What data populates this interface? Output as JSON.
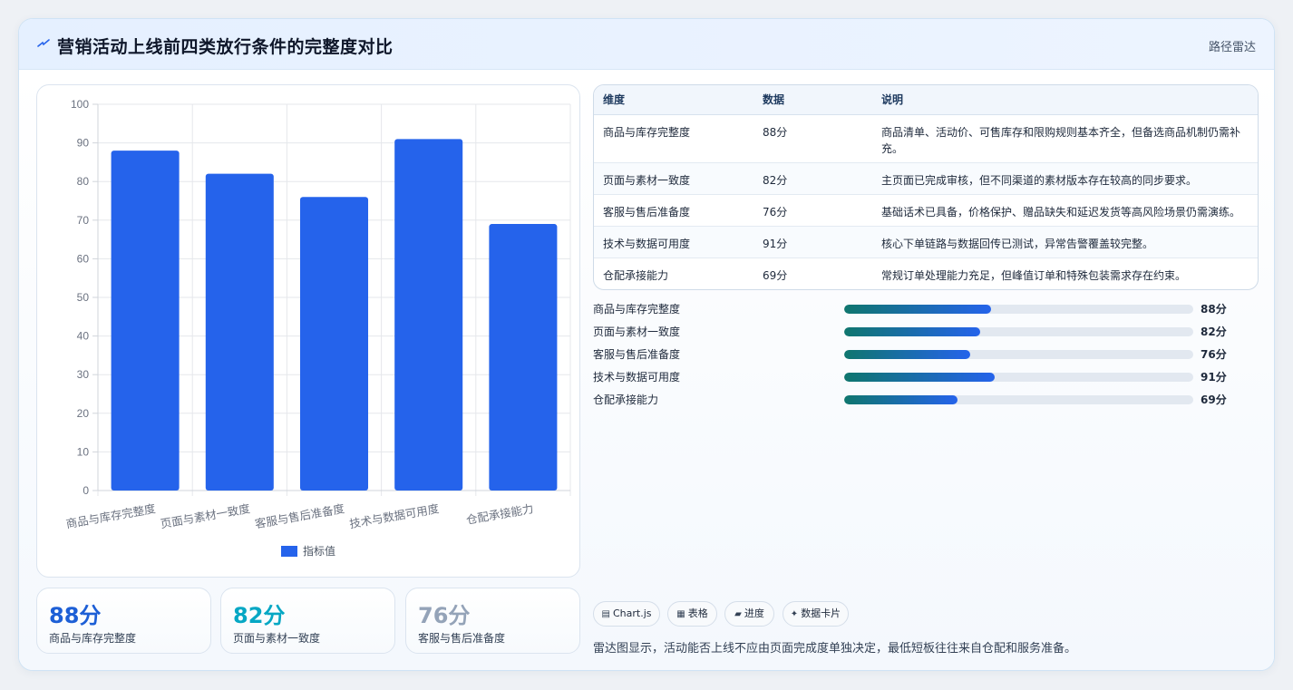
{
  "header": {
    "title": "营销活动上线前四类放行条件的完整度对比",
    "mode_label": "路径雷达",
    "logo_icon": "lightning-icon"
  },
  "chart_data": {
    "type": "bar",
    "categories": [
      "商品与库存完整度",
      "页面与素材一致度",
      "客服与售后准备度",
      "技术与数据可用度",
      "仓配承接能力"
    ],
    "series": [
      {
        "name": "指标值",
        "values": [
          88,
          82,
          76,
          91,
          69
        ],
        "color": "#2563eb"
      }
    ],
    "ylim": [
      0,
      100
    ],
    "yticks": [
      0,
      10,
      20,
      30,
      40,
      50,
      60,
      70,
      80,
      90,
      100
    ],
    "grid": true,
    "legend": "bottom"
  },
  "stats": [
    {
      "value": "88分",
      "label": "商品与库存完整度",
      "color": "#1d5fd6"
    },
    {
      "value": "82分",
      "label": "页面与素材一致度",
      "color": "#06a7c4"
    },
    {
      "value": "76分",
      "label": "客服与售后准备度",
      "color": "#94a3b8"
    }
  ],
  "table": {
    "headers": [
      "维度",
      "数据",
      "说明"
    ],
    "rows": [
      {
        "dim": "商品与库存完整度",
        "val": "88分",
        "note": "商品清单、活动价、可售库存和限购规则基本齐全，但备选商品机制仍需补充。"
      },
      {
        "dim": "页面与素材一致度",
        "val": "82分",
        "note": "主页面已完成审核，但不同渠道的素材版本存在较高的同步要求。"
      },
      {
        "dim": "客服与售后准备度",
        "val": "76分",
        "note": "基础话术已具备，价格保护、赠品缺失和延迟发货等高风险场景仍需演练。"
      },
      {
        "dim": "技术与数据可用度",
        "val": "91分",
        "note": "核心下单链路与数据回传已测试，异常告警覆盖较完整。"
      },
      {
        "dim": "仓配承接能力",
        "val": "69分",
        "note": "常规订单处理能力充足，但峰值订单和特殊包装需求存在约束。"
      }
    ]
  },
  "progress": [
    {
      "label": "商品与库存完整度",
      "value_text": "88分",
      "fraction": 0.42
    },
    {
      "label": "页面与素材一致度",
      "value_text": "82分",
      "fraction": 0.39
    },
    {
      "label": "客服与售后准备度",
      "value_text": "76分",
      "fraction": 0.36
    },
    {
      "label": "技术与数据可用度",
      "value_text": "91分",
      "fraction": 0.43
    },
    {
      "label": "仓配承接能力",
      "value_text": "69分",
      "fraction": 0.325
    }
  ],
  "chips": [
    {
      "icon": "chart-icon",
      "glyph": "▤",
      "label": "Chart.js"
    },
    {
      "icon": "table-icon",
      "glyph": "▦",
      "label": "表格"
    },
    {
      "icon": "progress-icon",
      "glyph": "▰",
      "label": "进度"
    },
    {
      "icon": "card-icon",
      "glyph": "✦",
      "label": "数据卡片"
    }
  ],
  "footer_note": "雷达图显示，活动能否上线不应由页面完成度单独决定，最低短板往往来自仓配和服务准备。"
}
